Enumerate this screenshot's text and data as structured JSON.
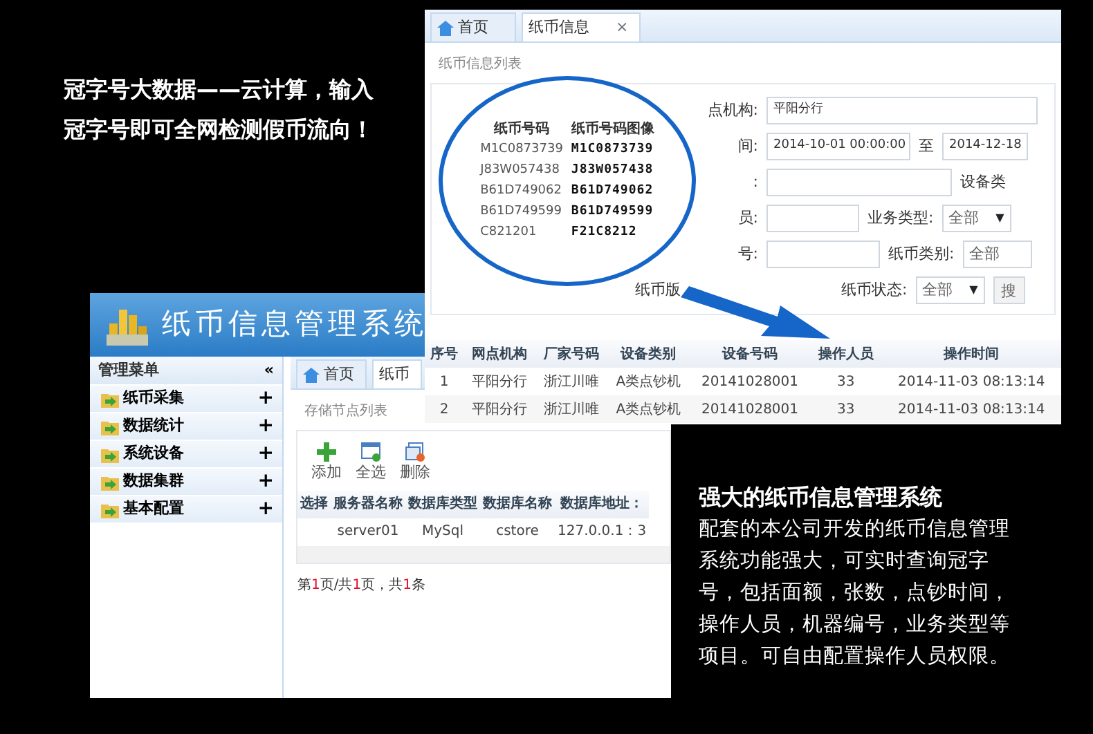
{
  "promo_heading": {
    "lines": [
      "冠字号大数据——云计算，输入",
      "冠字号即可全网检测假币流向！"
    ]
  },
  "info_window": {
    "tabs": [
      {
        "label": "首页",
        "icon": true,
        "selected": false,
        "closable": false
      },
      {
        "label": "纸币信息",
        "icon": false,
        "selected": true,
        "closable": true
      }
    ],
    "close_glyph": "×",
    "panel_title": "纸币信息列表",
    "form_rows": [
      [
        {
          "kind": "label",
          "text": "点机构:"
        },
        {
          "kind": "input",
          "value": "平阳分行"
        }
      ],
      [
        {
          "kind": "label",
          "text": "间:"
        },
        {
          "kind": "input",
          "value": "2014-10-01 00:00:00"
        },
        {
          "kind": "text",
          "text": "至"
        },
        {
          "kind": "input",
          "value": "2014-12-18"
        }
      ],
      [
        {
          "kind": "label",
          "text": ":"
        },
        {
          "kind": "input"
        },
        {
          "kind": "text",
          "text": "设备类"
        }
      ],
      [
        {
          "kind": "label",
          "text": "员:"
        },
        {
          "kind": "input"
        },
        {
          "kind": "text",
          "text": "业务类型:"
        },
        {
          "kind": "select",
          "value": "全部",
          "caret": "▼"
        }
      ],
      [
        {
          "kind": "label",
          "text": "号:"
        },
        {
          "kind": "input"
        },
        {
          "kind": "text",
          "text": "纸币类别:"
        },
        {
          "kind": "select",
          "value": "全部"
        }
      ],
      [
        {
          "kind": "label",
          "text": "纸币版"
        },
        {
          "kind": "gap"
        },
        {
          "kind": "text",
          "text": "纸币状态:"
        },
        {
          "kind": "select",
          "value": "全部",
          "caret": "▼"
        },
        {
          "kind": "button",
          "text": "搜"
        }
      ]
    ],
    "magnifier": {
      "columns": [
        "纸币号码",
        "纸币号码图像"
      ],
      "rows": [
        [
          "M1C0873739",
          "M1C0873739"
        ],
        [
          "J83W057438",
          "J83W057438"
        ],
        [
          "B61D749062",
          "B61D749062"
        ],
        [
          "B61D749599",
          "B61D749599"
        ],
        [
          "C821201",
          "F21C8212"
        ]
      ]
    },
    "table": {
      "columns": [
        "序号",
        "网点机构",
        "厂家号码",
        "设备类别",
        "设备号码",
        "操作人员",
        "操作时间"
      ],
      "rows": [
        [
          "1",
          "平阳分行",
          "浙江川唯",
          "A类点钞机",
          "20141028001",
          "33",
          "2014-11-03 08:13:14"
        ],
        [
          "2",
          "平阳分行",
          "浙江川唯",
          "A类点钞机",
          "20141028001",
          "33",
          "2014-11-03 08:13:14"
        ]
      ]
    }
  },
  "admin_window": {
    "title": "纸币信息管理系统",
    "menu_title": "管理菜单",
    "collapse_glyph": "«",
    "menu_items": [
      {
        "label": "纸币采集",
        "expander": "+"
      },
      {
        "label": "数据统计",
        "expander": "+"
      },
      {
        "label": "系统设备",
        "expander": "+"
      },
      {
        "label": "数据集群",
        "expander": "+"
      },
      {
        "label": "基本配置",
        "expander": "+"
      }
    ],
    "tabs": [
      {
        "label": "首页",
        "icon": true,
        "selected": false
      },
      {
        "label": "纸币",
        "icon": false,
        "selected": true
      }
    ],
    "panel_title": "存储节点列表",
    "toolbar": [
      {
        "kind": "add",
        "label": "添加"
      },
      {
        "kind": "select_all",
        "label": "全选"
      },
      {
        "kind": "delete",
        "label": "删除"
      }
    ],
    "table": {
      "columns": [
        "选择",
        "服务器名称",
        "数据库类型",
        "数据库名称",
        "数据库地址："
      ],
      "rows": [
        [
          "",
          "server01",
          "MySql",
          "cstore",
          "127.0.0.1：3"
        ]
      ]
    },
    "pager": [
      {
        "text": "第",
        "highlight": false
      },
      {
        "text": "1",
        "highlight": true
      },
      {
        "text": "页/共",
        "highlight": false
      },
      {
        "text": "1",
        "highlight": true
      },
      {
        "text": "页，共",
        "highlight": false
      },
      {
        "text": "1",
        "highlight": true
      },
      {
        "text": "条",
        "highlight": false
      }
    ]
  },
  "feature_text": {
    "title": "强大的纸币信息管理系统",
    "body": "配套的本公司开发的纸币信息管理系统功能强大，可实时查询冠字号，包括面额，张数，点钞时间，操作人员，机器编号，业务类型等项目。可自由配置操作人员权限。"
  }
}
